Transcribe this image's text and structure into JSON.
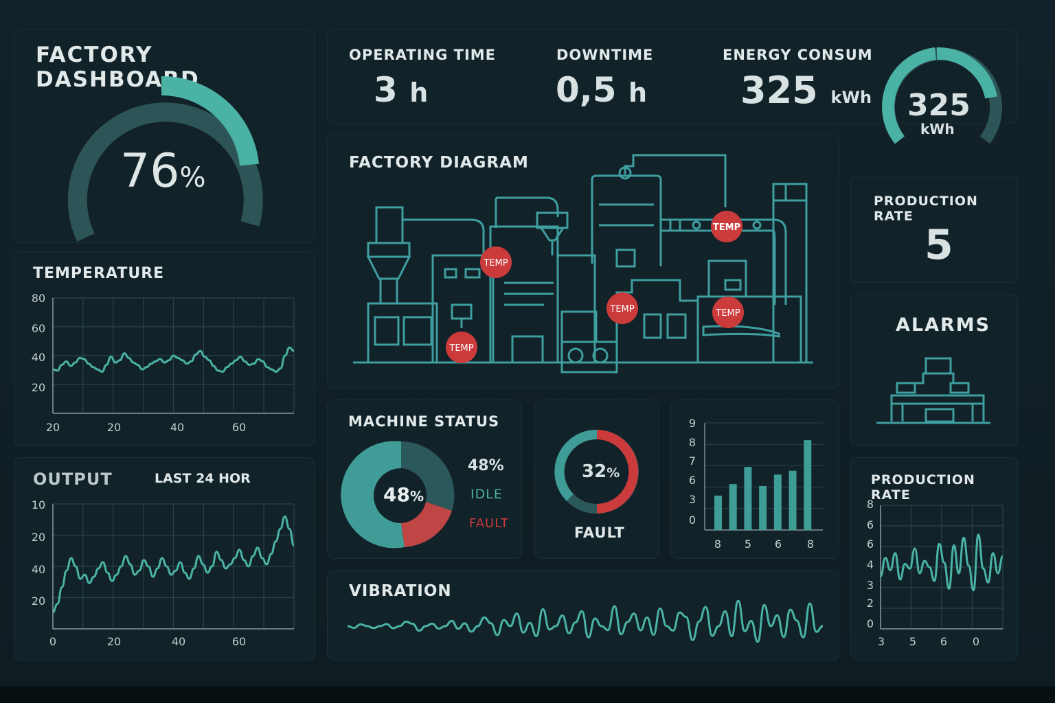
{
  "colors": {
    "accent": "#4ab3a6",
    "fault": "#cc3b3b",
    "panel": "#122229",
    "track": "#2d5558",
    "text": "#e1e9e9"
  },
  "dashboard": {
    "title": "FACTORY DASHBOARD",
    "gauge_value": "76",
    "gauge_unit": "%",
    "gauge_fraction": 0.76
  },
  "kpis": {
    "operating": {
      "label": "OPERATING TIME",
      "value": "3",
      "unit": "h"
    },
    "downtime": {
      "label": "DOWNTIME",
      "value": "0,5",
      "unit": "h"
    },
    "energy": {
      "label": "ENERGY CONSUM",
      "value": "325",
      "unit": "kWh"
    },
    "energy_gauge": {
      "value": "325",
      "unit": "kWh"
    }
  },
  "diagram": {
    "title": "FACTORY DIAGRAM",
    "sensor_label": "TEMP"
  },
  "production_rate": {
    "label": "PRODUCTION RATE",
    "value": "5"
  },
  "alarms": {
    "label": "ALARMS",
    "icon": "control-panel-icon"
  },
  "temperature": {
    "title": "TEMPERATURE"
  },
  "output": {
    "title": "OUTPUT",
    "subtitle": "LAST 24 HOR"
  },
  "machine_status": {
    "title": "MACHINE STATUS",
    "center": "48",
    "center_unit": "%",
    "legend_value": "48%",
    "legend_idle": "IDLE",
    "legend_fault": "FAULT"
  },
  "fault": {
    "value": "32",
    "unit": "%",
    "label": "FAULT",
    "fraction": 0.32
  },
  "vibration": {
    "title": "VIBRATION"
  },
  "production_rate_chart": {
    "title": "PRODUCTION RATE"
  },
  "chart_data": [
    {
      "type": "line",
      "title": "TEMPERATURE",
      "x_ticks": [
        "20",
        "20",
        "40",
        "60"
      ],
      "y_ticks": [
        "80",
        "60",
        "40",
        "20"
      ],
      "values": [
        38,
        37,
        42,
        45,
        41,
        44,
        48,
        47,
        43,
        40,
        38,
        36,
        42,
        49,
        44,
        46,
        52,
        48,
        44,
        42,
        38,
        40,
        43,
        45,
        47,
        44,
        46,
        50,
        48,
        46,
        43,
        45,
        51,
        54,
        49,
        46,
        41,
        37,
        36,
        40,
        43,
        46,
        49,
        45,
        42,
        43,
        47,
        45,
        40,
        38,
        36,
        39,
        50,
        57,
        54
      ]
    },
    {
      "type": "line",
      "title": "OUTPUT",
      "subtitle": "LAST 24 HOR",
      "x_ticks": [
        "0",
        "20",
        "40",
        "60"
      ],
      "y_ticks": [
        "10",
        "20",
        "40",
        "20"
      ],
      "values": [
        18,
        22,
        30,
        38,
        44,
        40,
        34,
        36,
        32,
        35,
        39,
        42,
        37,
        33,
        36,
        40,
        45,
        41,
        36,
        38,
        43,
        40,
        35,
        39,
        44,
        40,
        36,
        38,
        42,
        37,
        34,
        39,
        45,
        41,
        37,
        40,
        47,
        43,
        39,
        41,
        44,
        48,
        43,
        40,
        45,
        49,
        44,
        41,
        46,
        52,
        58,
        64,
        58,
        50
      ]
    },
    {
      "type": "pie",
      "title": "MACHINE STATUS",
      "slices": [
        {
          "label": "IDLE",
          "value": 48
        },
        {
          "label": "",
          "value": 32
        },
        {
          "label": "FAULT",
          "value": 20
        }
      ]
    },
    {
      "type": "pie",
      "title": "FAULT",
      "slices": [
        {
          "label": "FAULT",
          "value": 32
        }
      ]
    },
    {
      "type": "bar",
      "x_ticks": [
        "8",
        "5",
        "6",
        "8"
      ],
      "y_ticks": [
        "9",
        "8",
        "7",
        "6",
        "3",
        "0"
      ],
      "values": [
        1.8,
        2.4,
        3.3,
        2.3,
        2.9,
        3.1,
        4.7
      ]
    },
    {
      "type": "line",
      "title": "VIBRATION",
      "values": [
        0,
        -1,
        1,
        0,
        -1,
        0,
        1,
        -1,
        0,
        2,
        1,
        -2,
        0,
        1,
        -1,
        0,
        2,
        -1,
        1,
        -2,
        0,
        3,
        1,
        -3,
        2,
        0,
        4,
        -2,
        1,
        -3,
        5,
        -1,
        0,
        3,
        -2,
        1,
        4,
        -3,
        2,
        0,
        -1,
        5,
        -2,
        1,
        3,
        -1,
        2,
        -2,
        4,
        0,
        -1,
        3,
        2,
        -3,
        1,
        4,
        -2,
        0,
        3,
        -2,
        5,
        -1,
        1,
        -3,
        4,
        0,
        2,
        -2,
        3,
        1,
        -2,
        4,
        -1,
        0
      ]
    },
    {
      "type": "line",
      "title": "PRODUCTION RATE",
      "x_ticks": [
        "3",
        "5",
        "6",
        "0"
      ],
      "y_ticks": [
        "8",
        "6",
        "6",
        "4",
        "3",
        "2",
        "0"
      ],
      "values": [
        3.4,
        4.6,
        3.8,
        4.9,
        3.2,
        4.2,
        3.9,
        5.2,
        3.6,
        4.4,
        4.0,
        3.1,
        5.5,
        4.3,
        2.6,
        5.4,
        3.6,
        5.9,
        4.1,
        2.5,
        6.1,
        3.9,
        3.0,
        4.9,
        3.6,
        4.7
      ]
    }
  ]
}
